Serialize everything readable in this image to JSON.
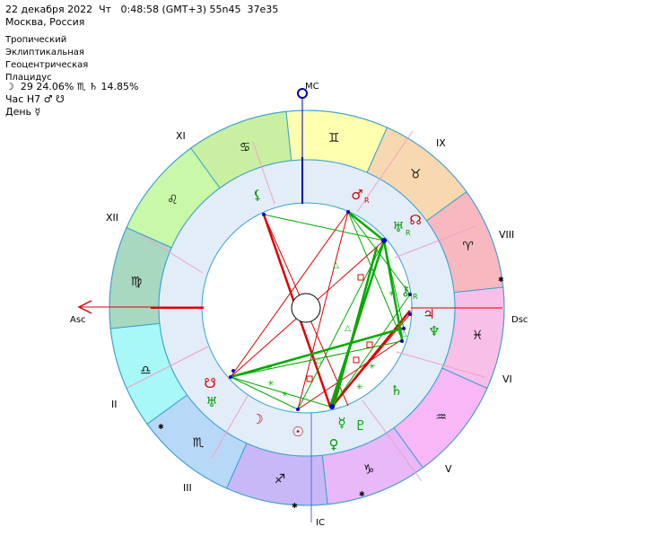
{
  "header": {
    "line1": "22 декабря 2022  Чт   0:48:58 (GMT+3) 55n45  37e35",
    "line2": "Москва, Россия",
    "line3": "Тропический",
    "line4": "Эклиптикальная",
    "line5": "Геоцентрическая",
    "line6": "Плацидус",
    "line7": "☽  29 24.06% ♏ ♄ 14.85%",
    "line8": "Час H7 ♂ ☋",
    "line9": "День ☿"
  },
  "axes": {
    "mc": "MC",
    "ic": "IC",
    "asc": "Asc",
    "dsc": "Dsc"
  },
  "houses": [
    "XI",
    "XII",
    "II",
    "III",
    "V",
    "VI",
    "VIII",
    "IX"
  ],
  "signs": [
    {
      "glyph": "♋",
      "name": "cancer-sign",
      "color": "#c8f0a0"
    },
    {
      "glyph": "♊",
      "name": "gemini-sign",
      "color": "#ffffb0"
    },
    {
      "glyph": "♉",
      "name": "taurus-sign",
      "color": "#f8d8b0"
    },
    {
      "glyph": "♈",
      "name": "aries-sign",
      "color": "#f8b8c0"
    },
    {
      "glyph": "♓",
      "name": "pisces-sign",
      "color": "#f8c0e8"
    },
    {
      "glyph": "♒",
      "name": "aquarius-sign",
      "color": "#f8b8f8"
    },
    {
      "glyph": "♑",
      "name": "capricorn-sign",
      "color": "#e8b8f8"
    },
    {
      "glyph": "♐",
      "name": "sagittarius-sign",
      "color": "#c8b8f8"
    },
    {
      "glyph": "♏",
      "name": "scorpio-sign",
      "color": "#b8d8f8"
    },
    {
      "glyph": "♎",
      "name": "libra-sign",
      "color": "#a8f8f8"
    },
    {
      "glyph": "♍",
      "name": "virgo-sign",
      "color": "#a8d8c0"
    },
    {
      "glyph": "♌",
      "name": "leo-sign",
      "color": "#c8f8a8"
    }
  ],
  "planets": [
    {
      "glyph": "⚸",
      "name": "lilith-icon",
      "color": "#009900"
    },
    {
      "glyph": "♂",
      "name": "mars-icon",
      "color": "#cc0000",
      "retro": "R"
    },
    {
      "glyph": "♅",
      "name": "uranus-icon",
      "color": "#009900",
      "retro": "R"
    },
    {
      "glyph": "☊",
      "name": "north-node-icon",
      "color": "#cc0000"
    },
    {
      "glyph": "⚷",
      "name": "chiron-icon",
      "color": "#009900",
      "retro": "R"
    },
    {
      "glyph": "♃",
      "name": "jupiter-icon",
      "color": "#cc0000"
    },
    {
      "glyph": "♆",
      "name": "neptune-icon",
      "color": "#009900"
    },
    {
      "glyph": "♄",
      "name": "saturn-icon",
      "color": "#009900"
    },
    {
      "glyph": "♇",
      "name": "pluto-icon",
      "color": "#009900"
    },
    {
      "glyph": "☿",
      "name": "mercury-icon",
      "color": "#009900"
    },
    {
      "glyph": "♀",
      "name": "venus-icon",
      "color": "#009900"
    },
    {
      "glyph": "☉",
      "name": "sun-icon",
      "color": "#cc0000"
    },
    {
      "glyph": "☽",
      "name": "moon-icon",
      "color": "#cc0000"
    },
    {
      "glyph": "☋",
      "name": "south-node-icon",
      "color": "#cc0000"
    },
    {
      "glyph": "♅",
      "name": "uranus-pf-icon",
      "color": "#009900"
    }
  ],
  "retro_label": "R",
  "colors": {
    "ring_stroke": "#3aa0d0",
    "inner_fill": "#e2edf8",
    "red": "#dd0000",
    "green": "#00aa00",
    "axis_blue": "#0000aa"
  }
}
